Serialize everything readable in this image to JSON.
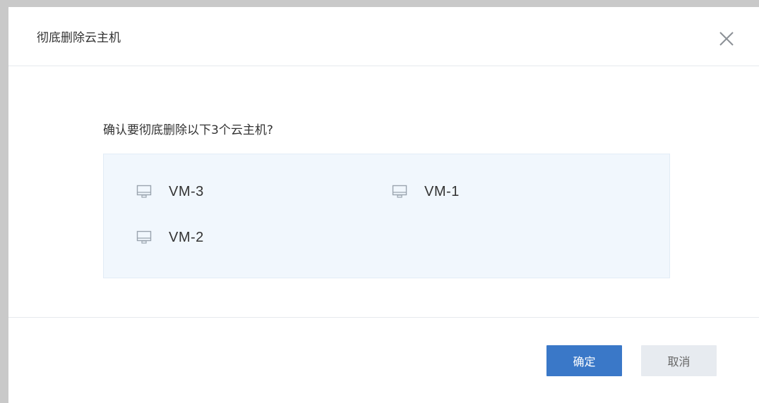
{
  "dialog": {
    "title": "彻底删除云主机",
    "close_icon": "close-icon",
    "question": "确认要彻底删除以下3个云主机?",
    "vms": [
      {
        "name": "VM-3",
        "icon": "monitor-icon"
      },
      {
        "name": "VM-1",
        "icon": "monitor-icon"
      },
      {
        "name": "VM-2",
        "icon": "monitor-icon"
      }
    ],
    "buttons": {
      "confirm_label": "确定",
      "cancel_label": "取消"
    }
  },
  "colors": {
    "primary": "#3a78c8",
    "list_background": "#f1f7fd",
    "cancel_background": "#e7ebf0"
  }
}
